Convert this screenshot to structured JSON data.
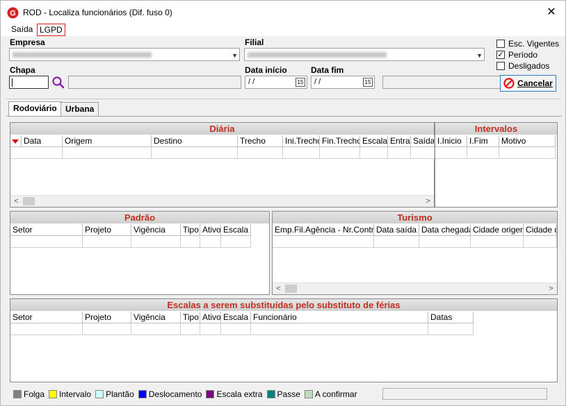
{
  "window": {
    "title": "ROD - Localiza funcionários (Dif. fuso 0)",
    "close_glyph": "✕"
  },
  "menu": {
    "items": [
      "Saída",
      "LGPD"
    ]
  },
  "form": {
    "empresa_label": "Empresa",
    "filial_label": "Filial",
    "chapa_label": "Chapa",
    "data_inicio_label": "Data início",
    "data_fim_label": "Data fim",
    "data_inicio_value": " /  /",
    "data_fim_value": " /  /",
    "calendar_glyph": "15",
    "dropdown_glyph": "▼"
  },
  "options": {
    "esc_vigentes": {
      "label": "Esc. Vigentes",
      "checked": false
    },
    "periodo": {
      "label": "Período",
      "checked": true
    },
    "desligados": {
      "label": "Desligados",
      "checked": false
    }
  },
  "cancel_button": {
    "label": "Cancelar"
  },
  "tabs": [
    "Rodoviário",
    "Urbana"
  ],
  "diaria": {
    "title": "Diária",
    "columns": [
      "Data",
      "Origem",
      "Destino",
      "Trecho",
      "Ini.Trecho",
      "Fin.Trecho",
      "Escala",
      "Entra",
      "Saída"
    ]
  },
  "intervalos": {
    "title": "Intervalos",
    "columns": [
      "I.Inicio",
      "I.Fim",
      "Motivo"
    ]
  },
  "padrao": {
    "title": "Padrão",
    "columns": [
      "Setor",
      "Projeto",
      "Vigência",
      "Tipo",
      "Ativo",
      "Escala"
    ]
  },
  "turismo": {
    "title": "Turismo",
    "columns": [
      "Emp.Fil.Agência - Nr.Contrato",
      "Data saída",
      "Data chegada",
      "Cidade origem",
      "Cidade de"
    ]
  },
  "escalas": {
    "title": "Escalas a serem substituídas pelo substituto de férias",
    "columns": [
      "Setor",
      "Projeto",
      "Vigência",
      "Tipo",
      "Ativo",
      "Escala",
      "Funcionário",
      "Datas"
    ]
  },
  "scroll": {
    "left_glyph": "<",
    "right_glyph": ">"
  },
  "legend": [
    {
      "label": "Folga",
      "color": "#808080"
    },
    {
      "label": "Intervalo",
      "color": "#ffff00"
    },
    {
      "label": "Plantão",
      "color": "#ccffff"
    },
    {
      "label": "Deslocamento",
      "color": "#0000ff"
    },
    {
      "label": "Escala extra",
      "color": "#800080"
    },
    {
      "label": "Passe",
      "color": "#008080"
    },
    {
      "label": "A confirmar",
      "color": "#c0dcc0"
    }
  ]
}
